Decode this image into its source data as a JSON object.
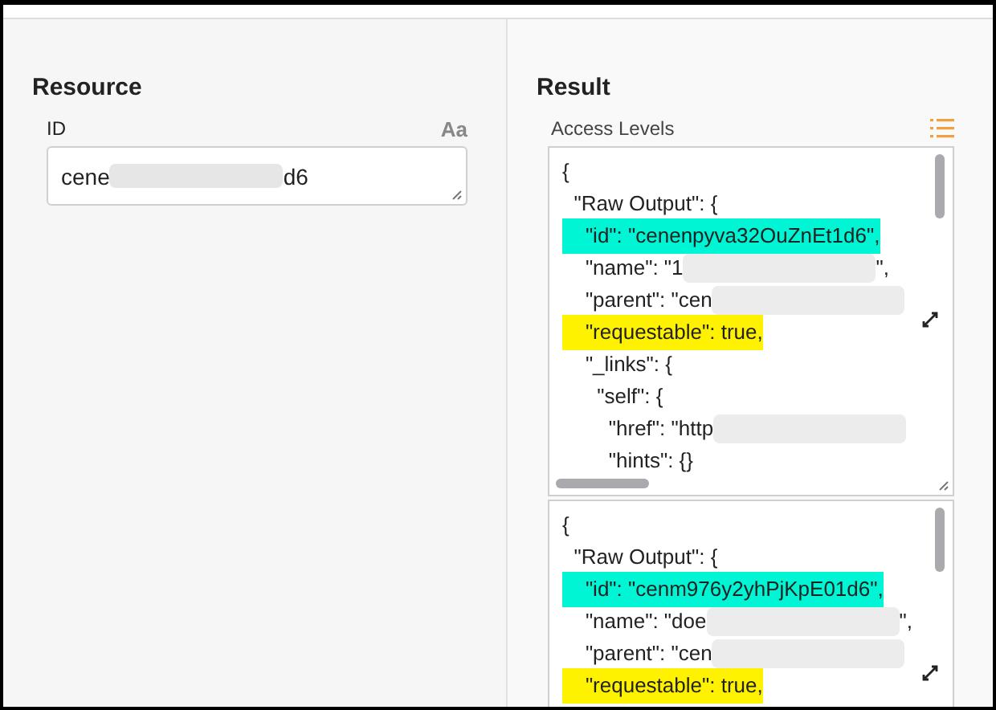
{
  "resource": {
    "heading": "Resource",
    "field": {
      "label": "ID",
      "format_hint": "Aa",
      "value_start": "cene",
      "value_end": "d6"
    }
  },
  "result": {
    "heading": "Result",
    "label": "Access Levels",
    "outputs": [
      {
        "lines": [
          {
            "text": "{"
          },
          {
            "text": "  \"Raw Output\": {"
          },
          {
            "text": "    \"id\": \"cenenpyva32OuZnEt1d6\",",
            "color": "#00f5d4"
          },
          {
            "text": "    \"name\": \"1",
            "redacted": true,
            "after": "\","
          },
          {
            "text": "    \"parent\": \"cen",
            "redacted": true
          },
          {
            "text": "    \"requestable\": true,",
            "color": "#fff200"
          },
          {
            "text": "    \"_links\": {"
          },
          {
            "text": "      \"self\": {"
          },
          {
            "text": "        \"href\": \"http",
            "redacted": true
          },
          {
            "text": "        \"hints\": {}"
          }
        ]
      },
      {
        "lines": [
          {
            "text": "{"
          },
          {
            "text": "  \"Raw Output\": {"
          },
          {
            "text": "    \"id\": \"cenm976y2yhPjKpE01d6\",",
            "color": "#00f5d4"
          },
          {
            "text": "    \"name\": \"doe",
            "redacted": true,
            "after": "\","
          },
          {
            "text": "    \"parent\": \"cen",
            "redacted": true
          },
          {
            "text": "    \"requestable\": true,",
            "color": "#fff200"
          }
        ]
      }
    ]
  }
}
